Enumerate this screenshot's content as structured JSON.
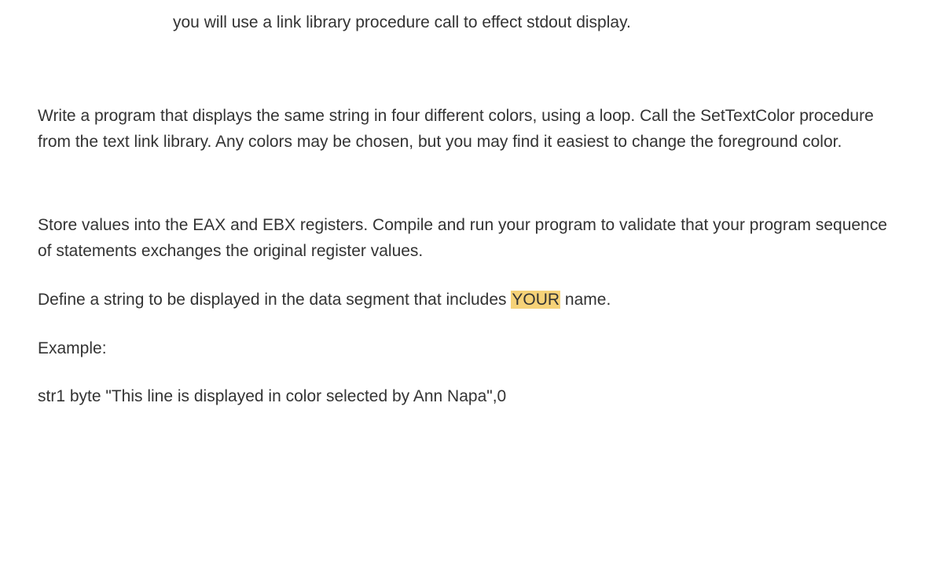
{
  "intro_line": "you will use a link library procedure call to effect stdout display.",
  "paragraph1": "Write a program that displays the same string in four different colors, using a loop.  Call the SetTextColor procedure from the text link library.  Any colors may be chosen, but you may find it easiest to change the foreground color.",
  "paragraph2": "Store values into the EAX and EBX registers. Compile and run your program to validate that your program sequence of statements exchanges the original register values.",
  "paragraph3_pre": "Define a string to be displayed in the data segment that includes ",
  "paragraph3_highlight": "YOUR",
  "paragraph3_post": " name.",
  "example_label": "Example:",
  "example_code": "str1 byte \"This line is displayed in color selected by Ann Napa\",0"
}
